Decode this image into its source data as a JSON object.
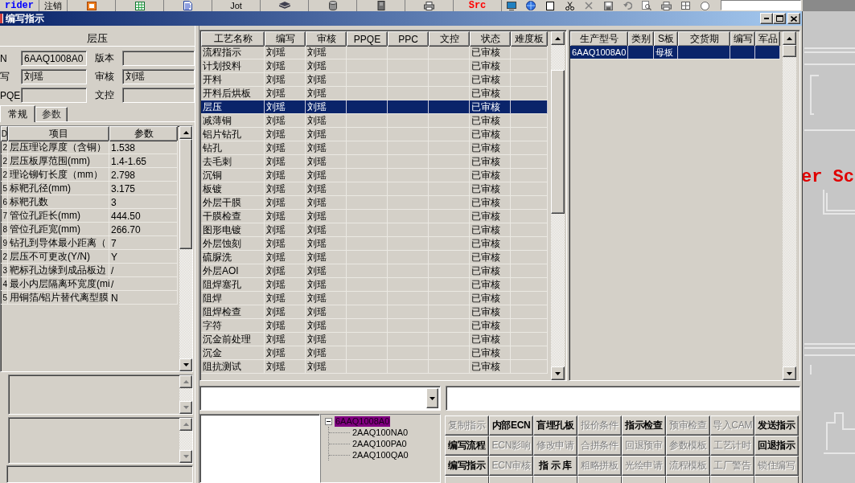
{
  "toolbar": {
    "items": [
      {
        "kind": "text",
        "label": "rider",
        "color": "#0000ff"
      },
      {
        "kind": "text",
        "label": "注销"
      },
      {
        "kind": "icon"
      },
      {
        "kind": "icon"
      },
      {
        "kind": "icon"
      },
      {
        "kind": "text",
        "label": "Jot"
      },
      {
        "kind": "icon"
      },
      {
        "kind": "icon"
      },
      {
        "kind": "icon"
      },
      {
        "kind": "icon"
      },
      {
        "kind": "text",
        "label": "Src",
        "color": "#ff0000"
      },
      {
        "kind": "small_icon"
      },
      {
        "kind": "small_icon"
      },
      {
        "kind": "small_icon"
      },
      {
        "kind": "small_icon"
      },
      {
        "kind": "small_icon"
      },
      {
        "kind": "small_icon"
      },
      {
        "kind": "small_icon"
      },
      {
        "kind": "small_icon"
      },
      {
        "kind": "small_icon"
      },
      {
        "kind": "small_icon"
      },
      {
        "kind": "small_icon"
      },
      {
        "kind": "field"
      }
    ]
  },
  "window": {
    "title": "编写指示"
  },
  "left_panel": {
    "heading": "层压",
    "fields": [
      {
        "label": "N",
        "value": "6AAQ1008A0"
      },
      {
        "label": "版本"
      },
      {
        "label": "写",
        "value": "刘瑶"
      },
      {
        "label": "审核",
        "value": "刘瑶"
      },
      {
        "label": "PQE"
      },
      {
        "label": "文控"
      }
    ],
    "tabs": [
      {
        "label": "常规",
        "selected": true
      },
      {
        "label": "参数",
        "selected": false
      }
    ],
    "grid": {
      "columns": [
        "D",
        "项目",
        "参数"
      ],
      "rows": [
        [
          "2",
          "层压理论厚度（含铜）",
          "1.538"
        ],
        [
          "2",
          "层压板厚范围(mm)",
          "1.4-1.65"
        ],
        [
          "2",
          "理论铆钉长度（mm）",
          "2.798"
        ],
        [
          "5",
          "标靶孔径(mm)",
          "3.175"
        ],
        [
          "6",
          "标靶孔数",
          "3"
        ],
        [
          "7",
          "管位孔距长(mm)",
          "444.50"
        ],
        [
          "8",
          "管位孔距宽(mm)",
          "266.70"
        ],
        [
          "9",
          "钻孔到导体最小距离（",
          "7"
        ],
        [
          "2",
          "层压不可更改(Y/N)",
          "Y"
        ],
        [
          "3",
          "靶标孔边缘到成品板边",
          "/"
        ],
        [
          "4",
          "最小内层隔离环宽度(mi",
          "/"
        ],
        [
          "5",
          "用铜箔/铝片替代离型膜",
          "N"
        ]
      ]
    }
  },
  "process_table": {
    "columns": [
      "工艺名称",
      "编写",
      "审核",
      "PPQE",
      "PPC",
      "文控",
      "状态",
      "难度板"
    ],
    "rows": [
      {
        "name": "流程指示",
        "writer": "刘瑶",
        "reviewer": "刘瑶",
        "status": "已审核",
        "selected": false
      },
      {
        "name": "计划投料",
        "writer": "刘瑶",
        "reviewer": "刘瑶",
        "status": "已审核",
        "selected": false
      },
      {
        "name": "开料",
        "writer": "刘瑶",
        "reviewer": "刘瑶",
        "status": "已审核",
        "selected": false
      },
      {
        "name": "开料后烘板",
        "writer": "刘瑶",
        "reviewer": "刘瑶",
        "status": "已审核",
        "selected": false
      },
      {
        "name": "层压",
        "writer": "刘瑶",
        "reviewer": "刘瑶",
        "status": "已审核",
        "selected": true
      },
      {
        "name": "减薄铜",
        "writer": "刘瑶",
        "reviewer": "刘瑶",
        "status": "已审核",
        "selected": false
      },
      {
        "name": "铝片钻孔",
        "writer": "刘瑶",
        "reviewer": "刘瑶",
        "status": "已审核",
        "selected": false
      },
      {
        "name": "钻孔",
        "writer": "刘瑶",
        "reviewer": "刘瑶",
        "status": "已审核",
        "selected": false
      },
      {
        "name": "去毛刺",
        "writer": "刘瑶",
        "reviewer": "刘瑶",
        "status": "已审核",
        "selected": false
      },
      {
        "name": "沉铜",
        "writer": "刘瑶",
        "reviewer": "刘瑶",
        "status": "已审核",
        "selected": false
      },
      {
        "name": "板镀",
        "writer": "刘瑶",
        "reviewer": "刘瑶",
        "status": "已审核",
        "selected": false
      },
      {
        "name": "外层干膜",
        "writer": "刘瑶",
        "reviewer": "刘瑶",
        "status": "已审核",
        "selected": false
      },
      {
        "name": "干膜检查",
        "writer": "刘瑶",
        "reviewer": "刘瑶",
        "status": "已审核",
        "selected": false
      },
      {
        "name": "图形电镀",
        "writer": "刘瑶",
        "reviewer": "刘瑶",
        "status": "已审核",
        "selected": false
      },
      {
        "name": "外层蚀刻",
        "writer": "刘瑶",
        "reviewer": "刘瑶",
        "status": "已审核",
        "selected": false
      },
      {
        "name": "硫脲洗",
        "writer": "刘瑶",
        "reviewer": "刘瑶",
        "status": "已审核",
        "selected": false
      },
      {
        "name": "外层AOI",
        "writer": "刘瑶",
        "reviewer": "刘瑶",
        "status": "已审核",
        "selected": false
      },
      {
        "name": "阻焊塞孔",
        "writer": "刘瑶",
        "reviewer": "刘瑶",
        "status": "已审核",
        "selected": false
      },
      {
        "name": "阻焊",
        "writer": "刘瑶",
        "reviewer": "刘瑶",
        "status": "已审核",
        "selected": false
      },
      {
        "name": "阻焊检查",
        "writer": "刘瑶",
        "reviewer": "刘瑶",
        "status": "已审核",
        "selected": false
      },
      {
        "name": "字符",
        "writer": "刘瑶",
        "reviewer": "刘瑶",
        "status": "已审核",
        "selected": false
      },
      {
        "name": "沉金前处理",
        "writer": "刘瑶",
        "reviewer": "刘瑶",
        "status": "已审核",
        "selected": false
      },
      {
        "name": "沉金",
        "writer": "刘瑶",
        "reviewer": "刘瑶",
        "status": "已审核",
        "selected": false
      },
      {
        "name": "阻抗测试",
        "writer": "刘瑶",
        "reviewer": "刘瑶",
        "status": "已审核",
        "selected": false
      }
    ]
  },
  "model_table": {
    "columns": [
      "生产型号",
      "类别",
      "S板",
      "交货期",
      "编写",
      "军品"
    ],
    "rows": [
      {
        "model": "6AAQ1008A0",
        "board": "母板",
        "selected": true
      }
    ]
  },
  "tree": {
    "items": [
      {
        "label": "6AAQ1008A0",
        "selected": true,
        "expanded": true,
        "children": [
          {
            "label": "2AAQ100NA0",
            "selected": false
          },
          {
            "label": "2AAQ100PA0",
            "selected": false
          },
          {
            "label": "2AAQ100QA0",
            "selected": false
          }
        ]
      }
    ]
  },
  "buttons": [
    {
      "kind": "button",
      "label": "复制指示",
      "disabled": true
    },
    {
      "kind": "button",
      "label": "内部ECN",
      "disabled": false
    },
    {
      "kind": "button",
      "label": "盲埋孔板",
      "disabled": false
    },
    {
      "kind": "button",
      "label": "报价条件",
      "disabled": true
    },
    {
      "kind": "button",
      "label": "指示检查",
      "disabled": false
    },
    {
      "kind": "button",
      "label": "预审检查",
      "disabled": true
    },
    {
      "kind": "button",
      "label": "导入CAM",
      "disabled": true
    },
    {
      "kind": "button",
      "label": "发送指示",
      "disabled": false
    },
    {
      "kind": "button",
      "label": "编写流程",
      "disabled": false
    },
    {
      "kind": "button",
      "label": "ECN影响",
      "disabled": true
    },
    {
      "kind": "button",
      "label": "修改申请",
      "disabled": true
    },
    {
      "kind": "button",
      "label": "合拼条件",
      "disabled": true
    },
    {
      "kind": "button",
      "label": "回退预审",
      "disabled": true
    },
    {
      "kind": "button",
      "label": "参数模板",
      "disabled": true
    },
    {
      "kind": "button",
      "label": "工艺计时",
      "disabled": true
    },
    {
      "kind": "button",
      "label": "回退指示",
      "disabled": false
    },
    {
      "kind": "button",
      "label": "编写指示",
      "disabled": false
    },
    {
      "kind": "button",
      "label": "ECN审核",
      "disabled": true
    },
    {
      "kind": "button",
      "label": "指 示 库",
      "disabled": false
    },
    {
      "kind": "button",
      "label": "粗略拼板",
      "disabled": true
    },
    {
      "kind": "button",
      "label": "光绘申请",
      "disabled": true
    },
    {
      "kind": "button",
      "label": "流程模板",
      "disabled": true
    },
    {
      "kind": "button",
      "label": "工厂警告",
      "disabled": true
    },
    {
      "kind": "button",
      "label": "锁住编写",
      "disabled": true
    },
    {
      "kind": "cut_off"
    },
    {
      "kind": "cut_off"
    },
    {
      "kind": "cut_off"
    },
    {
      "kind": "cut_off"
    },
    {
      "kind": "cut_off"
    },
    {
      "kind": "cut_off"
    },
    {
      "kind": "cut_off"
    },
    {
      "kind": "cut_off"
    }
  ],
  "desktop": {
    "text": "er Sc"
  }
}
